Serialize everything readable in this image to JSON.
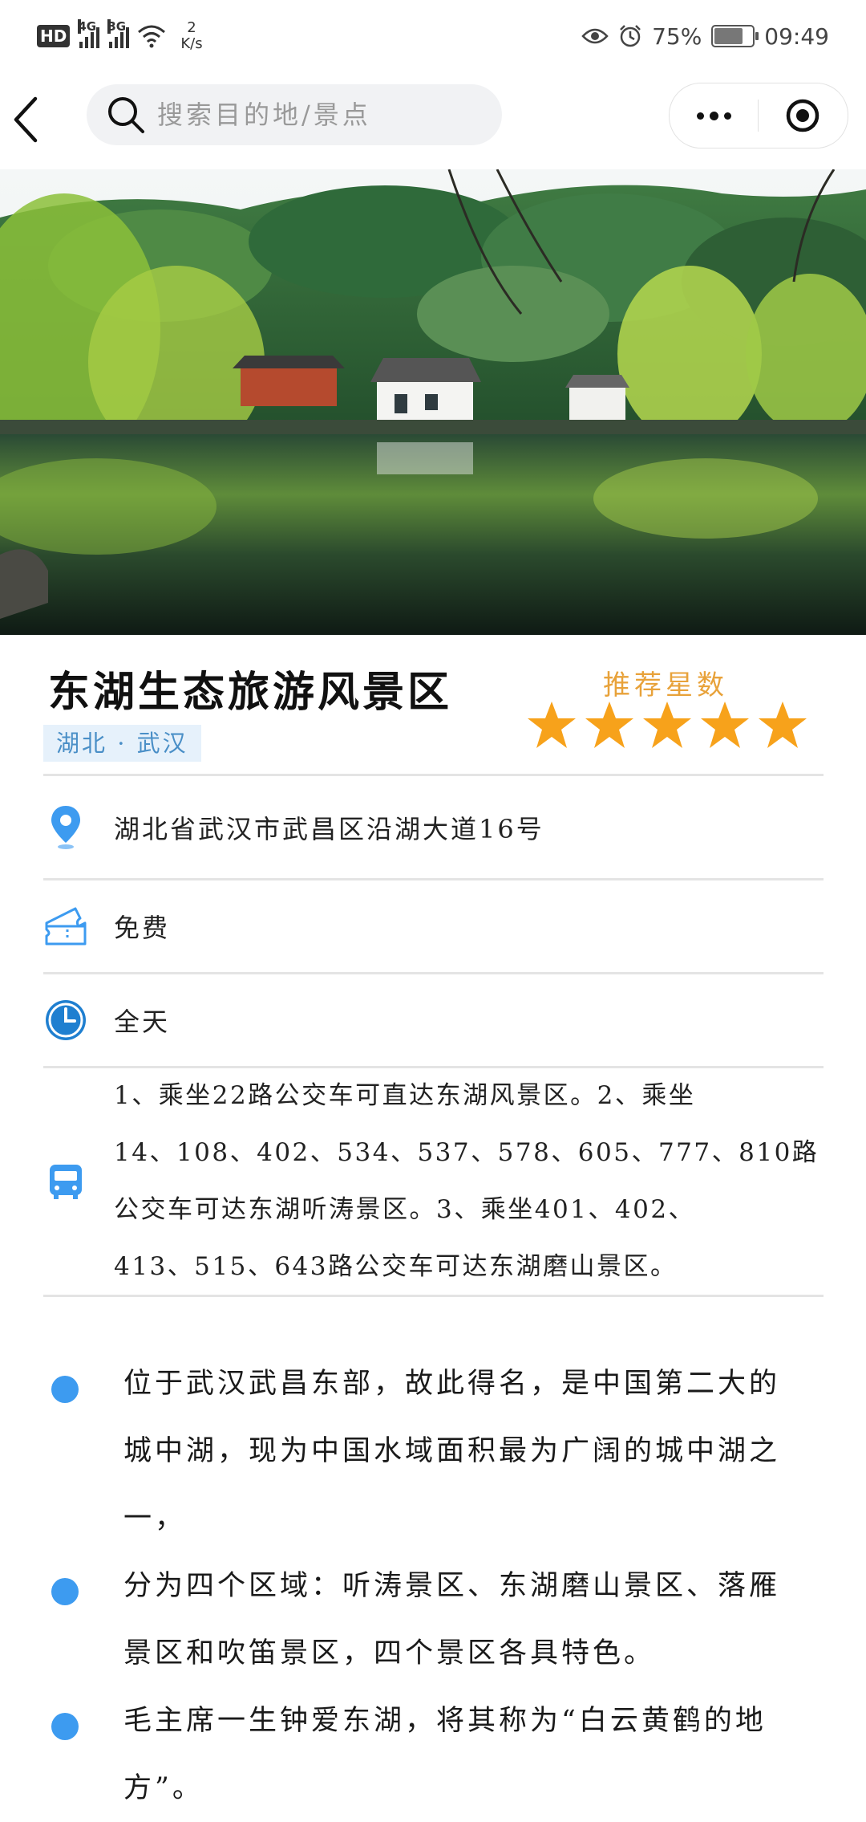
{
  "status_bar": {
    "hd": "HD",
    "net1": "4G",
    "net2": "3G",
    "speed_value": "2",
    "speed_unit": "K/s",
    "battery": "75%",
    "battery_level": 0.75,
    "time": "09:49"
  },
  "nav": {
    "search_placeholder": "搜索目的地/景点"
  },
  "attraction": {
    "name": "东湖生态旅游风景区",
    "region": "湖北 · 武汉",
    "rating_label": "推荐星数",
    "rating": 5,
    "rating_max": 5,
    "star_color": "#f7a21b",
    "address": "湖北省武汉市武昌区沿湖大道16号",
    "price": "免费",
    "hours": "全天",
    "transport_lines": [
      "1、乘坐22路公交车可直达东湖风景区。2、乘坐",
      "14、108、402、534、537、578、605、777、810路",
      "公交车可达东湖听涛景区。3、乘坐401、402、",
      "413、515、643路公交车可达东湖磨山景区。"
    ],
    "description": [
      {
        "lines": [
          "位于武汉武昌东部，故此得名，是中国第二大的",
          "城中湖，现为中国水域面积最为广阔的城中湖之",
          "一，"
        ]
      },
      {
        "lines": [
          "分为四个区域：听涛景区、东湖磨山景区、落雁",
          "景区和吹笛景区，四个景区各具特色。"
        ]
      },
      {
        "lines": [
          "毛主席一生钟爱东湖，将其称为“白云黄鹤的地",
          "方”。"
        ]
      }
    ]
  },
  "colors": {
    "accent_blue": "#3d9bf0",
    "region_text": "#4a8fc7",
    "region_bg": "#e6f1fb",
    "rating_label": "#e8a23a"
  },
  "icons": [
    "back-arrow-icon",
    "search-icon",
    "more-dots-icon",
    "close-target-icon",
    "location-pin-icon",
    "ticket-icon",
    "clock-icon",
    "bus-icon"
  ]
}
